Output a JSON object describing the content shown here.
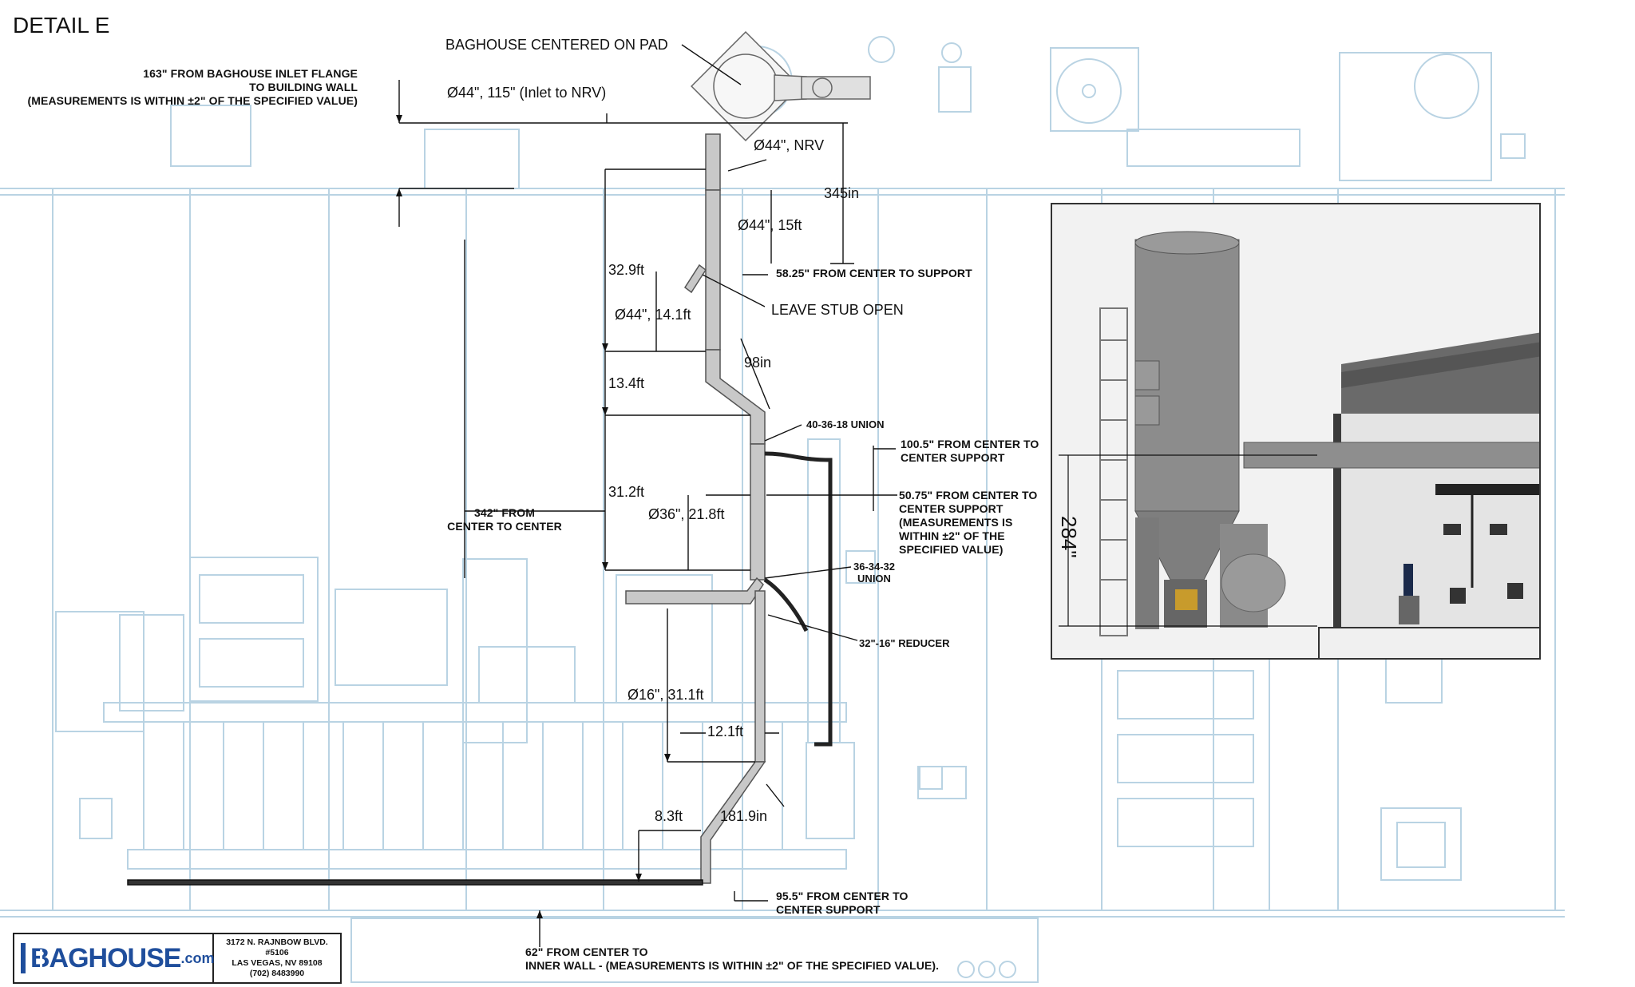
{
  "detail_title": "DETAIL E",
  "callouts": {
    "baghouse_centered": "BAGHOUSE CENTERED ON PAD",
    "flange_line1": "163\" FROM BAGHOUSE INLET FLANGE",
    "flange_line2": "TO BUILDING WALL",
    "flange_line3": "(MEASUREMENTS IS WITHIN ±2\" OF THE SPECIFIED VALUE)",
    "inlet_nrv": "Ø44\", 115\" (Inlet to NRV)",
    "nrv": "Ø44\", NRV",
    "d345": "345in",
    "d44_15": "Ø44\", 15ft",
    "d329": "32.9ft",
    "support_5825": "58.25\" FROM CENTER TO SUPPORT",
    "leave_stub": "LEAVE STUB OPEN",
    "d44_141": "Ø44\", 14.1ft",
    "d98": "98in",
    "d134": "13.4ft",
    "union_40": "40-36-18 UNION",
    "support_1005_l1": "100.5\" FROM CENTER TO",
    "support_1005_l2": "CENTER SUPPORT",
    "d312": "31.2ft",
    "c2c_l1": "342\" FROM",
    "c2c_l2": "CENTER TO CENTER",
    "d36_218": "Ø36\", 21.8ft",
    "support_5075_l1": "50.75\" FROM CENTER TO",
    "support_5075_l2": "CENTER SUPPORT",
    "support_5075_l3": "(MEASUREMENTS IS",
    "support_5075_l4": "WITHIN ±2\" OF THE",
    "support_5075_l5": "SPECIFIED VALUE)",
    "union_36_l1": "36-34-32",
    "union_36_l2": "UNION",
    "reducer": "32\"-16\" REDUCER",
    "d16_311": "Ø16\", 31.1ft",
    "d121": "12.1ft",
    "d83": "8.3ft",
    "d1819": "181.9in",
    "support_955_l1": "95.5\" FROM CENTER TO",
    "support_955_l2": "CENTER SUPPORT",
    "wall_l1": "62\" FROM CENTER TO",
    "wall_l2": "INNER WALL - (MEASUREMENTS IS WITHIN ±2\" OF THE SPECIFIED VALUE)."
  },
  "inset": {
    "dimension": "284\""
  },
  "title_block": {
    "logo_text": "BAGHOUSE",
    "logo_suffix": ".com",
    "address_line1": "3172 N. RAJNBOW BLVD.",
    "address_line2": "#5106",
    "address_line3": "LAS VEGAS, NV 89108",
    "address_line4": "(702) 8483990"
  },
  "colors": {
    "background_plan": "#b9d3e3",
    "duct": "#8a8a8a",
    "dimension_line": "#111111",
    "inset_bg": "#f2f2f2",
    "logo_blue": "#1f4e9c"
  }
}
